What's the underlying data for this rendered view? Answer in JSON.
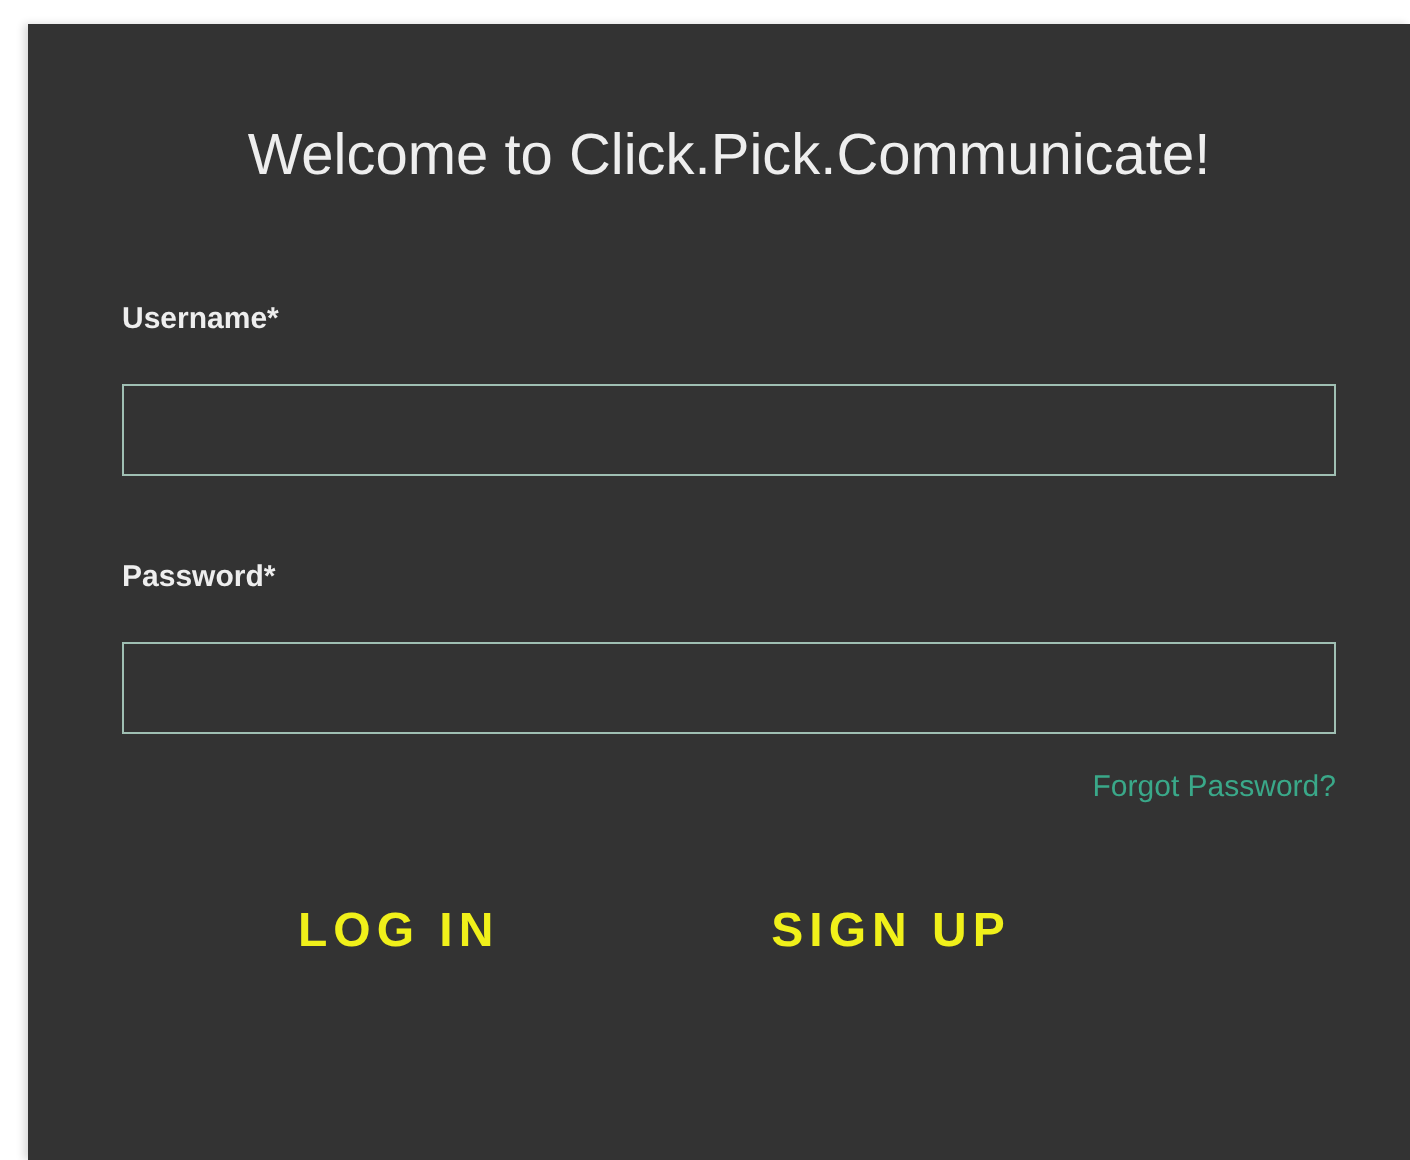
{
  "title": "Welcome to Click.Pick.Communicate!",
  "fields": [
    {
      "label": "Username*"
    },
    {
      "label": "Password*"
    }
  ],
  "forgot_link": "Forgot Password?",
  "buttons": [
    "LOG IN",
    "SIGN UP"
  ]
}
